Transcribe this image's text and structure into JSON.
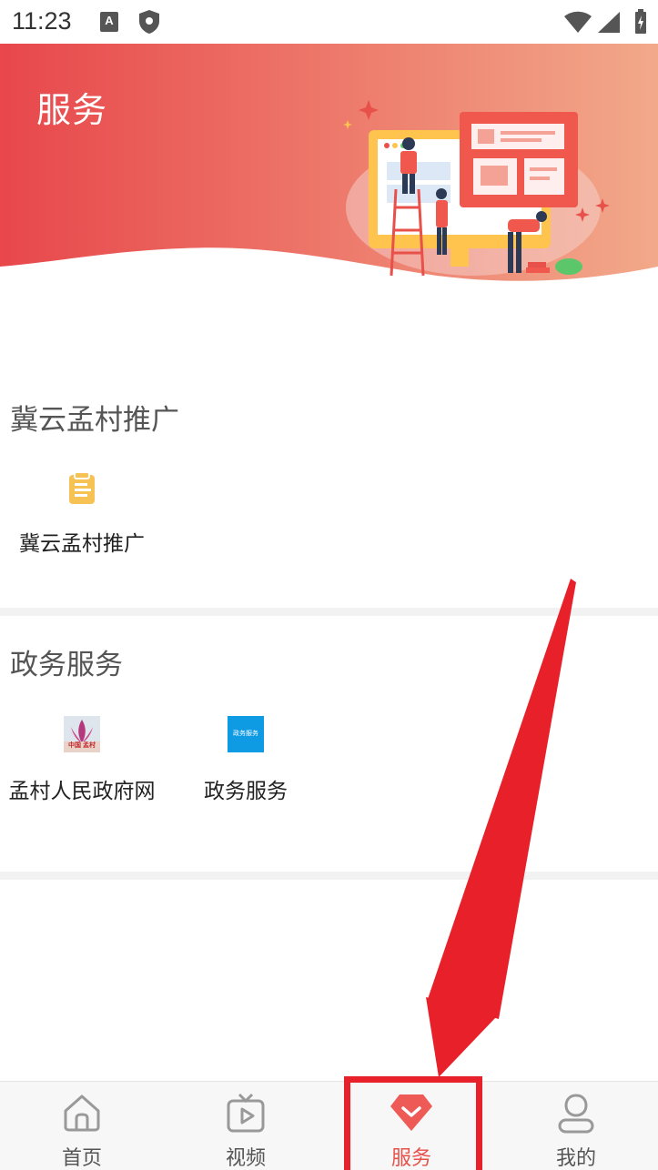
{
  "status_bar": {
    "time": "11:23",
    "icons": [
      "a-notification-icon",
      "shield-icon",
      "wifi-icon",
      "signal-icon",
      "battery-icon"
    ]
  },
  "header": {
    "title": "服务",
    "gradient_start": "#e84b4b",
    "gradient_end": "#f2a88a"
  },
  "sections": [
    {
      "title": "冀云孟村推广",
      "tiles": [
        {
          "label": "冀云孟村推广",
          "icon": "document-clipboard-icon"
        }
      ]
    },
    {
      "title": "政务服务",
      "tiles": [
        {
          "label": "孟村人民政府网",
          "icon": "mengcun-government-logo",
          "logo_text": "中国 孟村"
        },
        {
          "label": "政务服务",
          "icon": "government-service-logo",
          "logo_text": "政务服务"
        }
      ]
    }
  ],
  "bottom_nav": {
    "items": [
      {
        "label": "首页",
        "icon": "home-icon",
        "active": false
      },
      {
        "label": "视频",
        "icon": "tv-play-icon",
        "active": false
      },
      {
        "label": "服务",
        "icon": "service-diamond-icon",
        "active": true
      },
      {
        "label": "我的",
        "icon": "user-icon",
        "active": false
      }
    ]
  },
  "colors": {
    "accent": "#e8504a",
    "annotation": "#e8202a"
  }
}
